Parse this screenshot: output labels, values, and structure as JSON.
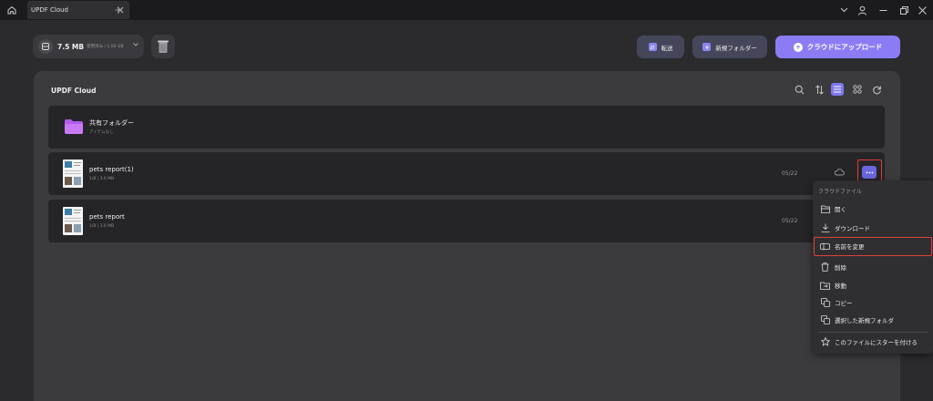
{
  "titlebar": {
    "tab_title": "UPDF Cloud",
    "icons": [
      "home-icon",
      "close-icon",
      "plus-icon",
      "chevron-down-icon",
      "user-icon",
      "minimize-icon",
      "restore-icon",
      "close-icon"
    ]
  },
  "toolbar": {
    "storage_size": "7.5 MB",
    "storage_sub": "使用済み / 1.00 GB",
    "transfer_label": "転送",
    "new_folder_label": "新規フォルダー",
    "upload_label": "クラウドにアップロード"
  },
  "panel": {
    "title": "UPDF Cloud",
    "rows": [
      {
        "name": "共有フォルダー",
        "meta": "アイテムなし",
        "date": ""
      },
      {
        "name": "pets report(1)",
        "meta": "1/8 | 3.6 MB",
        "date": "05/22"
      },
      {
        "name": "pets report",
        "meta": "1/8 | 3.6 MB",
        "date": "05/22"
      }
    ]
  },
  "menu": {
    "header": "クラウドファイル",
    "items": [
      {
        "label": "開く",
        "icon": "folder-open-icon"
      },
      {
        "label": "ダウンロード",
        "icon": "download-icon"
      },
      {
        "label": "名前を変更",
        "icon": "rename-icon"
      },
      {
        "label": "削除",
        "icon": "trash-icon"
      },
      {
        "label": "移動",
        "icon": "move-icon"
      },
      {
        "label": "コピー",
        "icon": "copy-icon"
      },
      {
        "label": "選択した新規フォルダ",
        "icon": "new-folder-icon"
      },
      {
        "label": "このファイルにスターを付ける",
        "icon": "star-icon"
      }
    ]
  },
  "colors": {
    "accent": "#8c7cf4",
    "highlight": "#e0403a",
    "background": "#2b2b2e",
    "panel": "#3b3b3e",
    "row": "#252527"
  }
}
